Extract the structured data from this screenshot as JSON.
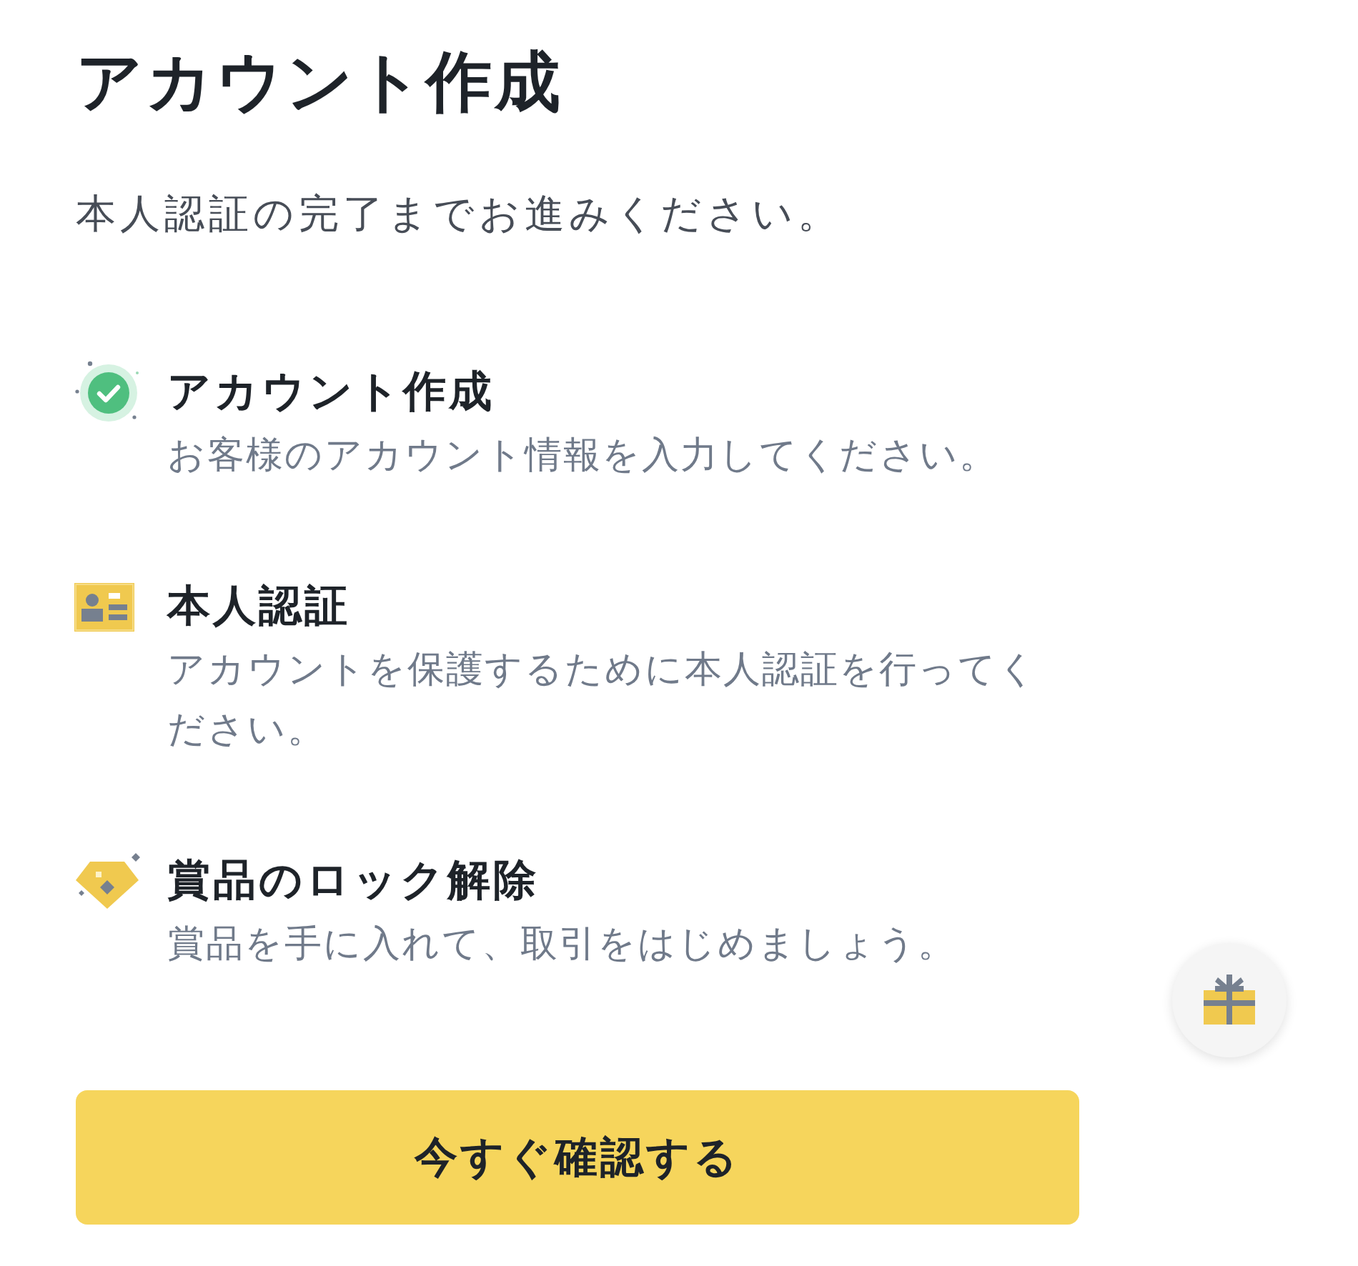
{
  "title": "アカウント作成",
  "subtitle": "本人認証の完了までお進みください。",
  "steps": [
    {
      "kind": "done",
      "title": "アカウント作成",
      "description": "お客様のアカウント情報を入力してください。"
    },
    {
      "kind": "id",
      "title": "本人認証",
      "description": "アカウントを保護するために本人認証を行ってください。"
    },
    {
      "kind": "reward",
      "title": "賞品のロック解除",
      "description": "賞品を手に入れて、取引をはじめましょう。"
    }
  ],
  "button": {
    "label": "今すぐ確認する"
  }
}
